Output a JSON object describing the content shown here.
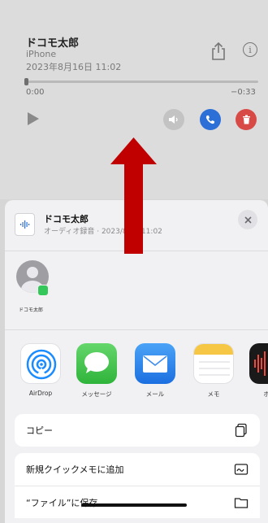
{
  "memo": {
    "name": "ドコモ太郎",
    "device": "iPhone",
    "date": "2023年8月16日 11:02",
    "time_start": "0:00",
    "time_end": "−0:33",
    "playback_progress": 0.0
  },
  "share_sheet": {
    "file_name": "ドコモ太郎",
    "file_subtitle": "オーディオ録音 · 2023/8/16 11:02",
    "contact": {
      "name": "ドコモ太郎"
    },
    "apps": [
      {
        "label": "AirDrop",
        "icon": "airdrop-icon"
      },
      {
        "label": "メッセージ",
        "icon": "messages-icon"
      },
      {
        "label": "メール",
        "icon": "mail-icon"
      },
      {
        "label": "メモ",
        "icon": "notes-icon"
      },
      {
        "label": "ボイ",
        "icon": "voice-memos-icon"
      }
    ],
    "actions": [
      {
        "label": "コピー",
        "icon": "copy-icon"
      },
      {
        "label": "新規クイックメモに追加",
        "icon": "quick-note-icon"
      },
      {
        "label": "“ファイル”に保存",
        "icon": "folder-icon"
      }
    ]
  },
  "colors": {
    "call": "#2c6fd6",
    "delete": "#d84a46",
    "arrow": "#c00000",
    "contact_badge": "#34c759"
  }
}
